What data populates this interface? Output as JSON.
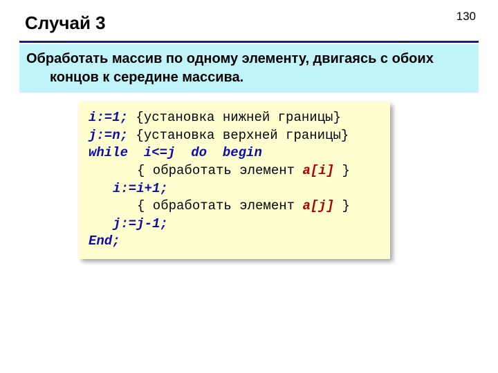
{
  "page_number": "130",
  "title": "Случай 3",
  "description": "Обработать массив по одному элементу, двигаясь с обоих концов к середине массива.",
  "code": {
    "l1_kw": "i:=1;",
    "l1_c": " {установка нижней границы}",
    "l2_kw": "j:=n;",
    "l2_c": " {установка верхней границы}",
    "l3_kw": "while  i<=j  do  begin",
    "l4_c1": "{ обработать элемент ",
    "l4_hl": "a[i]",
    "l4_c2": " }",
    "l5_kw": "i:=i+1;",
    "l6_c1": "{ обработать элемент ",
    "l6_hl": "a[j]",
    "l6_c2": " }",
    "l7_kw": "j:=j-1;",
    "l8_kw": "End;"
  }
}
